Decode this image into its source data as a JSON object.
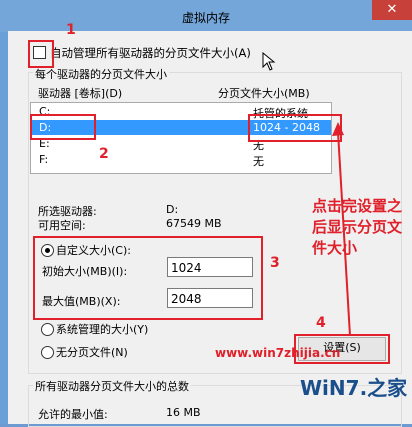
{
  "window": {
    "title": "虚拟内存",
    "close_label": "✕"
  },
  "auto_manage": {
    "label": "自动管理所有驱动器的分页文件大小(A)",
    "checked": false
  },
  "per_drive": {
    "group_label": "每个驱动器的分页文件大小",
    "col_drive": "驱动器 [卷标](D)",
    "col_size": "分页文件大小(MB)",
    "rows": [
      {
        "drive": "C:",
        "size": "托管的系统"
      },
      {
        "drive": "D:",
        "size": "1024 - 2048"
      },
      {
        "drive": "E:",
        "size": "无"
      },
      {
        "drive": "F:",
        "size": "无"
      }
    ],
    "selected_row": 1,
    "selected_drive_label": "所选驱动器:",
    "selected_drive_value": "D:",
    "free_space_label": "可用空间:",
    "free_space_value": "67549 MB",
    "custom_size_label": "自定义大小(C):",
    "initial_size_label": "初始大小(MB)(I):",
    "initial_size_value": "1024",
    "max_size_label": "最大值(MB)(X):",
    "max_size_value": "2048",
    "system_managed_label": "系统管理的大小(Y)",
    "no_paging_label": "无分页文件(N)",
    "set_button": "设置(S)",
    "selected_option": "custom"
  },
  "totals": {
    "group_label": "所有驱动器分页文件大小的总数",
    "min_allowed_label": "允许的最小值:",
    "min_allowed_value": "16 MB"
  },
  "annotations": {
    "steps": [
      "1",
      "2",
      "3",
      "4"
    ],
    "note": [
      "点击完设置之",
      "后显示分页文",
      "件大小"
    ],
    "watermark_url": "www.win7zhijia.cn",
    "logo_text": "WiN7.之家"
  },
  "colors": {
    "annotation": "#e0202a",
    "selection": "#3399ff",
    "title_bar": "#74a6da"
  },
  "icons": {
    "close": "close-icon",
    "cursor": "mouse-pointer-icon",
    "arrow": "annotation-arrow-icon"
  }
}
